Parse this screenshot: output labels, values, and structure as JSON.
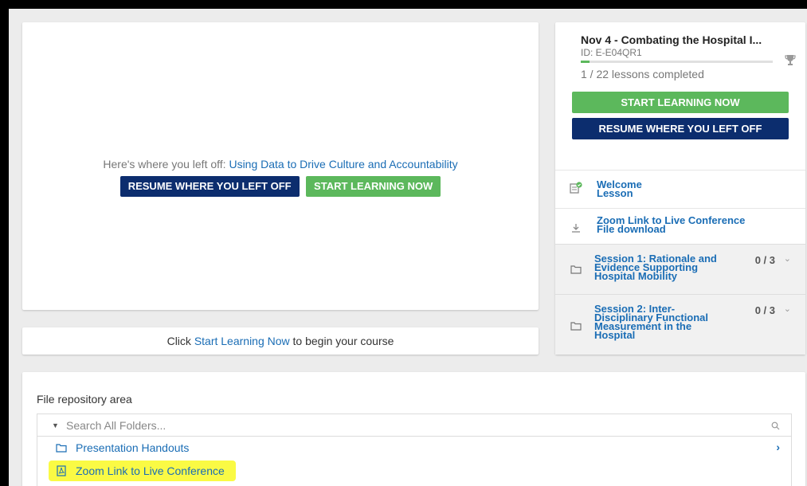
{
  "hero": {
    "left_off_prefix": "Here's where you left off:",
    "left_off_link": "Using Data to Drive Culture and Accountability",
    "resume_label": "RESUME WHERE YOU LEFT OFF",
    "start_label": "START LEARNING NOW"
  },
  "cta": {
    "prefix": "Click",
    "link": "Start Learning Now",
    "suffix": "to begin your course"
  },
  "course": {
    "title": "Nov 4 - Combating the Hospital I...",
    "id": "ID: E-E04QR1",
    "lessons_completed": "1 / 22 lessons completed",
    "progress_fraction": 0.045,
    "start_label": "START LEARNING NOW",
    "resume_label": "RESUME WHERE YOU LEFT OFF",
    "items": [
      {
        "title": "Welcome",
        "subtitle": "Lesson",
        "icon": "lesson-complete-icon"
      },
      {
        "title": "Zoom Link to Live Conference",
        "subtitle": "File download",
        "icon": "download-icon"
      }
    ],
    "sessions": [
      {
        "title_lines": [
          "Session 1: Rationale and",
          "Evidence Supporting",
          "Hospital Mobility"
        ],
        "count": "0 / 3",
        "icon": "folder-icon"
      },
      {
        "title_lines": [
          "Session 2: Inter-",
          "Disciplinary Functional",
          "Measurement in the",
          "Hospital"
        ],
        "count": "0 / 3",
        "icon": "folder-icon"
      }
    ]
  },
  "repo": {
    "label": "File repository area",
    "search_placeholder": "Search All Folders...",
    "folder": "Presentation Handouts",
    "file": "Zoom Link to Live Conference"
  },
  "colors": {
    "navy": "#0c2d6e",
    "green": "#5cb85c",
    "link": "#1a6db5",
    "highlight": "#fafa44"
  }
}
